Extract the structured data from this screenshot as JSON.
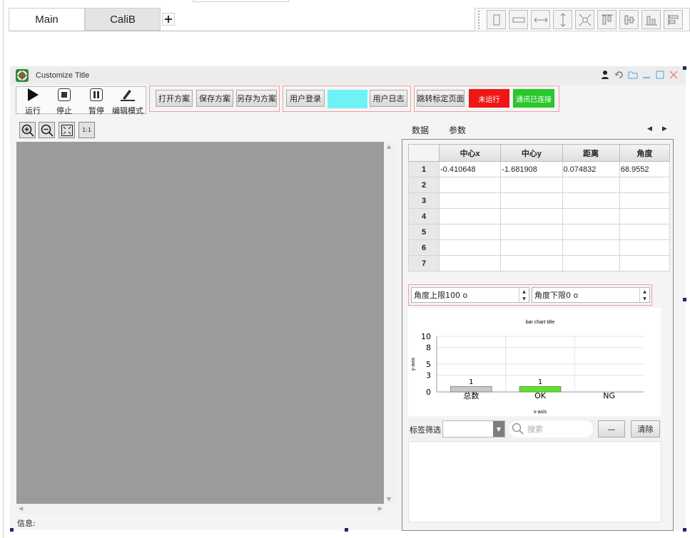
{
  "tabs": [
    {
      "label": "Main",
      "active": true
    },
    {
      "label": "CaliB",
      "active": false
    }
  ],
  "add_tab_label": "+",
  "window": {
    "title": "Customize Title"
  },
  "toolbar": {
    "run_label": "运行",
    "stop_label": "停止",
    "pause_label": "暂停",
    "edit_mode_label": "编辑模式",
    "open_plan_label": "打开方案",
    "save_plan_label": "保存方案",
    "save_as_label": "另存为方案",
    "user_login_label": "用户登录",
    "user_log_label": "用户日志",
    "goto_calib_label": "跳转标定页面",
    "run_status_label": "未运行",
    "comm_status_label": "通讯已连接"
  },
  "colors": {
    "run_status_bg": "#ef1616",
    "comm_status_bg": "#28c82a",
    "login_field_bg": "#6ff2f6",
    "canvas_bg": "#9b9b9b",
    "total_bar": "#c8c8c8",
    "ok_bar": "#5ee22a"
  },
  "zoom_tools": [
    "zoom-in-icon",
    "zoom-out-icon",
    "fit-screen-icon",
    "actual-size-icon"
  ],
  "zoom_one_to_one_label": "1:1",
  "info_label": "信息:",
  "right_panel": {
    "tabs": [
      "数据",
      "参数"
    ],
    "columns": [
      "中心x",
      "中心y",
      "距离",
      "角度"
    ],
    "rows": [
      {
        "index": "1",
        "cells": [
          "-0.410648",
          "-1.681908",
          "0.074832",
          "68.9552"
        ]
      },
      {
        "index": "2",
        "cells": [
          "",
          "",
          "",
          ""
        ]
      },
      {
        "index": "3",
        "cells": [
          "",
          "",
          "",
          ""
        ]
      },
      {
        "index": "4",
        "cells": [
          "",
          "",
          "",
          ""
        ]
      },
      {
        "index": "5",
        "cells": [
          "",
          "",
          "",
          ""
        ]
      },
      {
        "index": "6",
        "cells": [
          "",
          "",
          "",
          ""
        ]
      },
      {
        "index": "7",
        "cells": [
          "",
          "",
          "",
          ""
        ]
      }
    ],
    "upper_limit": "角度上限100  o",
    "lower_limit": "角度下限0  o",
    "filter_label": "标签筛选",
    "search_placeholder": "搜索",
    "minus_label": "—",
    "clear_label": "清除"
  },
  "chart_data": {
    "type": "bar",
    "title": "bar chart title",
    "xlabel": "x-axis",
    "ylabel": "y-axis",
    "categories": [
      "总数",
      "OK",
      "NG"
    ],
    "values": [
      1,
      1,
      0
    ],
    "data_labels": [
      "1",
      "1",
      ""
    ],
    "y_ticks": [
      "10",
      "8",
      "5",
      "3",
      "0"
    ],
    "ylim": [
      0,
      10
    ],
    "grid": true,
    "bar_colors": [
      "#c8c8c8",
      "#5ee22a",
      "#c8c8c8"
    ]
  }
}
